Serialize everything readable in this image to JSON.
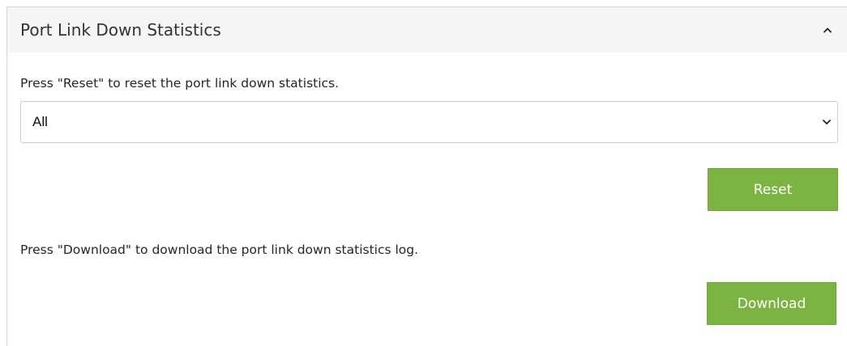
{
  "panel": {
    "title": "Port Link Down Statistics",
    "collapse_icon": "chevron-up-icon"
  },
  "reset_section": {
    "instruction": "Press \"Reset\" to reset the port link down statistics.",
    "select": {
      "selected_value": "All",
      "icon": "chevron-down-icon"
    },
    "reset_button_label": "Reset"
  },
  "download_section": {
    "instruction": "Press \"Download\" to download the port link down statistics log.",
    "download_button_label": "Download"
  },
  "colors": {
    "button_green": "#7cb342",
    "header_bg": "#f5f5f5"
  }
}
